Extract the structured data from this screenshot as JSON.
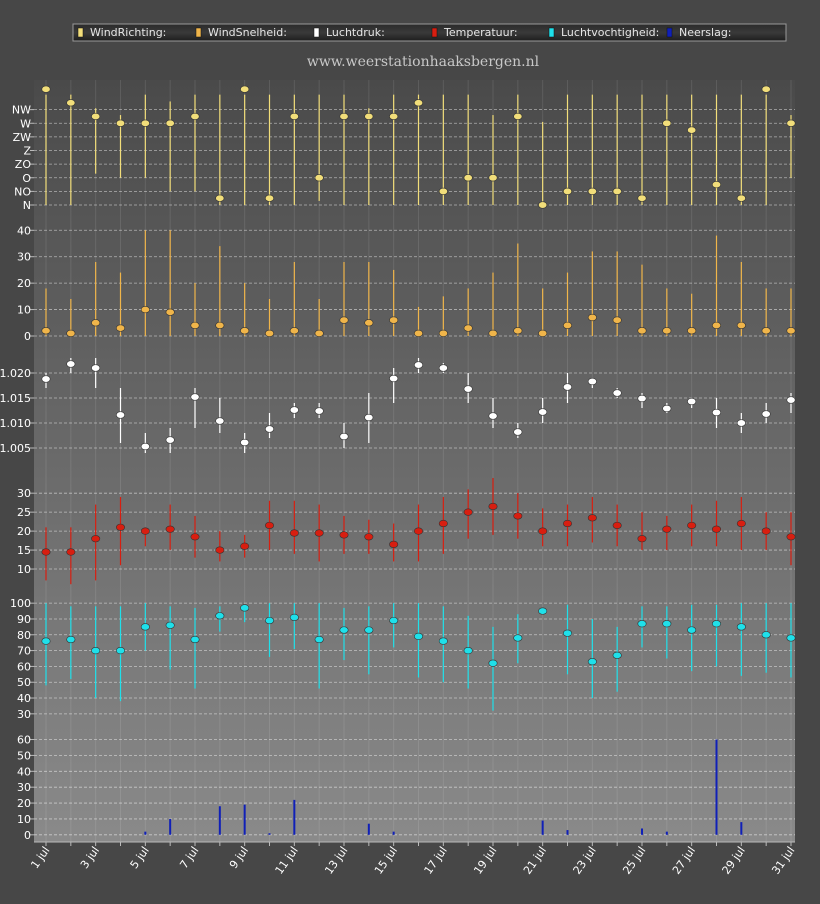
{
  "site_url": "www.weerstationhaaksbergen.nl",
  "legend": [
    {
      "label": "WindRichting:",
      "color": "#f2de7a"
    },
    {
      "label": "WindSnelheid:",
      "color": "#f0b54a"
    },
    {
      "label": "Luchtdruk:",
      "color": "#ffffff"
    },
    {
      "label": "Temperatuur:",
      "color": "#d81e10"
    },
    {
      "label": "Luchtvochtigheid:",
      "color": "#1fe0ea"
    },
    {
      "label": "Neerslag:",
      "color": "#1020b8"
    }
  ],
  "chart_data": {
    "type": "scatter",
    "x_label_every": 2,
    "days": [
      "1 jul",
      "2 jul",
      "3 jul",
      "4 jul",
      "5 jul",
      "6 jul",
      "7 jul",
      "8 jul",
      "9 jul",
      "10 jul",
      "11 jul",
      "12 jul",
      "13 jul",
      "14 jul",
      "15 jul",
      "16 jul",
      "17 jul",
      "18 jul",
      "19 jul",
      "20 jul",
      "21 jul",
      "22 jul",
      "23 jul",
      "24 jul",
      "25 jul",
      "26 jul",
      "27 jul",
      "28 jul",
      "29 jul",
      "30 jul",
      "31 jul"
    ],
    "panels": [
      {
        "name": "WindRichting",
        "color": "#f2de7a",
        "category_ticks": [
          "N",
          "NO",
          "O",
          "ZO",
          "Z",
          "ZW",
          "W",
          "NW"
        ],
        "ylim": [
          0,
          8
        ],
        "values": [
          8.5,
          7.5,
          6.5,
          6,
          6,
          6,
          6.5,
          0.5,
          8.5,
          0.5,
          6.5,
          2,
          6.5,
          6.5,
          6.5,
          7.5,
          1,
          2,
          2,
          6.5,
          0,
          1,
          1,
          1,
          0.5,
          6,
          5.5,
          1.5,
          0.5,
          8.5,
          6
        ],
        "low": [
          0,
          0,
          2.3,
          2,
          2,
          1,
          1,
          0,
          0,
          0,
          0,
          0.3,
          0,
          0,
          0,
          0,
          0,
          0,
          0,
          0,
          0,
          0,
          0,
          0,
          0,
          0,
          0,
          0,
          0,
          0,
          2
        ],
        "high": [
          8.1,
          8.1,
          7.1,
          6.6,
          8.1,
          7.6,
          8.1,
          8.1,
          8.1,
          8.1,
          8.1,
          8.1,
          8.1,
          7.1,
          8.1,
          8.1,
          8.1,
          8.1,
          6.6,
          8.1,
          6.1,
          8.1,
          8.1,
          8.1,
          8.1,
          8.1,
          8.1,
          8.1,
          8.1,
          8.1,
          6.6
        ]
      },
      {
        "name": "WindSnelheid",
        "color": "#f0b54a",
        "ticks": [
          0,
          10,
          20,
          30,
          40
        ],
        "ylim": [
          0,
          42
        ],
        "values": [
          2,
          1,
          5,
          3,
          10,
          9,
          4,
          4,
          2,
          1,
          2,
          1,
          6,
          5,
          6,
          1,
          1,
          3,
          1,
          2,
          1,
          4,
          7,
          6,
          2,
          2,
          2,
          4,
          4,
          2,
          2
        ],
        "low": [
          0,
          0,
          0,
          0,
          0,
          0,
          0,
          0,
          0,
          0,
          0,
          0,
          0,
          0,
          0,
          0,
          0,
          0,
          0,
          0,
          0,
          0,
          0,
          0,
          0,
          0,
          0,
          0,
          0,
          0,
          0
        ],
        "high": [
          18,
          14,
          28,
          24,
          40,
          40,
          20,
          34,
          20,
          14,
          28,
          14,
          28,
          28,
          25,
          11,
          15,
          18,
          24,
          35,
          18,
          24,
          32,
          32,
          27,
          18,
          16,
          38,
          28,
          18,
          18
        ]
      },
      {
        "name": "Luchtdruk",
        "color": "#ffffff",
        "ticks": [
          1.005,
          1.01,
          1.015,
          1.02
        ],
        "tick_labels": [
          "1.005",
          "1.010",
          "1.015",
          "1.020"
        ],
        "ylim": [
          1.002,
          1.025
        ],
        "values": [
          1.0188,
          1.0218,
          1.021,
          1.0116,
          1.0053,
          1.0066,
          1.0152,
          1.0104,
          1.0061,
          1.0088,
          1.0126,
          1.0124,
          1.0073,
          1.0111,
          1.0189,
          1.0216,
          1.021,
          1.0168,
          1.0114,
          1.0082,
          1.0122,
          1.0172,
          1.0183,
          1.016,
          1.0149,
          1.0129,
          1.0143,
          1.0121,
          1.01,
          1.0118,
          1.0146
        ],
        "low": [
          1.017,
          1.02,
          1.017,
          1.006,
          1.004,
          1.004,
          1.009,
          1.008,
          1.004,
          1.007,
          1.011,
          1.011,
          1.005,
          1.006,
          1.014,
          1.02,
          1.02,
          1.014,
          1.009,
          1.007,
          1.01,
          1.014,
          1.017,
          1.015,
          1.013,
          1.012,
          1.013,
          1.009,
          1.008,
          1.01,
          1.012
        ],
        "high": [
          1.02,
          1.023,
          1.023,
          1.017,
          1.008,
          1.009,
          1.017,
          1.015,
          1.008,
          1.012,
          1.014,
          1.014,
          1.01,
          1.016,
          1.021,
          1.023,
          1.022,
          1.02,
          1.015,
          1.01,
          1.015,
          1.02,
          1.019,
          1.017,
          1.016,
          1.014,
          1.015,
          1.015,
          1.012,
          1.014,
          1.016
        ]
      },
      {
        "name": "Temperatuur",
        "color": "#d81e10",
        "ticks": [
          10,
          15,
          20,
          25,
          30
        ],
        "ylim": [
          5,
          34
        ],
        "values": [
          14.5,
          14.5,
          18,
          21,
          20,
          20.5,
          18.5,
          15,
          16,
          21.5,
          19.5,
          19.5,
          19,
          18.5,
          16.5,
          20,
          22,
          25,
          26.5,
          24,
          20,
          22,
          23.5,
          21.5,
          18,
          20.5,
          21.5,
          20.5,
          22,
          20,
          18.5
        ],
        "low": [
          7,
          6,
          7,
          11,
          16,
          15,
          13,
          12,
          13,
          15,
          14,
          12,
          14,
          14,
          12,
          12,
          14,
          18,
          19,
          18,
          16,
          16,
          17,
          16,
          15,
          15,
          16,
          16,
          15,
          15,
          11
        ],
        "high": [
          21,
          21,
          27,
          29,
          21,
          27,
          24,
          20,
          19,
          28,
          28,
          27,
          24,
          23,
          22,
          27,
          29,
          31,
          34,
          30,
          26,
          27,
          29,
          27,
          25,
          24,
          27,
          28,
          29,
          25,
          25
        ]
      },
      {
        "name": "Luchtvochtigheid",
        "color": "#1fe0ea",
        "ticks": [
          30,
          40,
          50,
          60,
          70,
          80,
          90,
          100
        ],
        "ylim": [
          28,
          102
        ],
        "values": [
          76,
          77,
          70,
          70,
          85,
          86,
          77,
          92,
          97,
          89,
          91,
          77,
          83,
          83,
          89,
          79,
          76,
          70,
          62,
          78,
          95,
          81,
          63,
          67,
          87,
          87,
          83,
          87,
          85,
          80,
          78
        ],
        "low": [
          48,
          52,
          40,
          38,
          70,
          58,
          46,
          82,
          88,
          66,
          71,
          46,
          64,
          55,
          72,
          53,
          50,
          46,
          32,
          62,
          93,
          55,
          40,
          44,
          72,
          65,
          57,
          60,
          54,
          56,
          53
        ],
        "high": [
          100,
          98,
          98,
          98,
          100,
          98,
          97,
          98,
          98,
          100,
          100,
          100,
          97,
          98,
          100,
          100,
          98,
          92,
          85,
          93,
          97,
          99,
          90,
          85,
          98,
          98,
          99,
          99,
          100,
          100,
          100
        ]
      },
      {
        "name": "Neerslag",
        "color": "#1020b8",
        "ticks": [
          0,
          10,
          20,
          30,
          40,
          50,
          60
        ],
        "ylim": [
          -2,
          66
        ],
        "values": [
          0,
          0,
          0,
          0,
          2,
          10,
          0,
          18,
          19,
          1,
          22,
          0,
          0,
          7,
          2,
          0,
          0,
          0,
          0,
          0,
          9,
          3,
          0,
          0,
          4,
          2,
          0,
          60,
          8,
          0,
          0
        ]
      }
    ]
  }
}
